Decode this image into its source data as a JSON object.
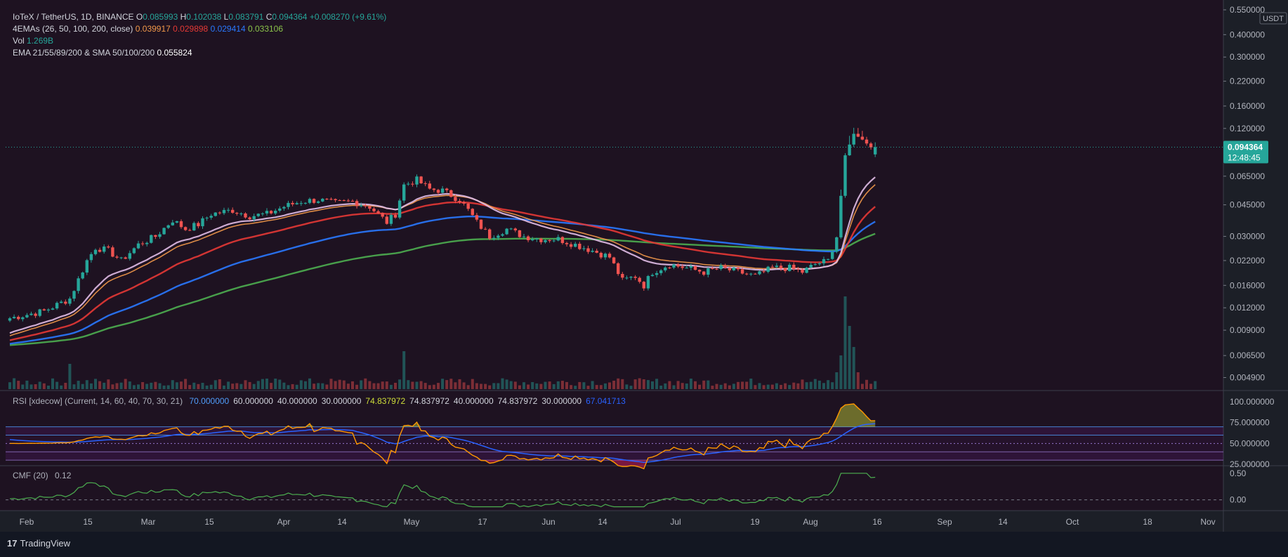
{
  "header": {
    "symbol": "IoTeX / TetherUS, 1D, BINANCE",
    "ohlc": [
      {
        "k": "O",
        "v": "0.085993"
      },
      {
        "k": "H",
        "v": "0.102038"
      },
      {
        "k": "L",
        "v": "0.083791"
      },
      {
        "k": "C",
        "v": "0.094364"
      }
    ],
    "change": "+0.008270 (+9.61%)",
    "change_color": "#26a69a",
    "ema4_label": "4EMAs (26, 50, 100, 200, close)",
    "ema4_values": [
      {
        "v": "0.039917",
        "color": "#f2994a"
      },
      {
        "v": "0.029898",
        "color": "#e53935"
      },
      {
        "v": "0.029414",
        "color": "#2979ff"
      },
      {
        "v": "0.033106",
        "color": "#8bc34a"
      }
    ],
    "vol_label": "Vol",
    "vol_value": "1.269B",
    "vol_color": "#26a69a",
    "ema_sma_label": "EMA 21/55/89/200 & SMA 50/100/200",
    "ema_sma_value": "0.055824",
    "ema_sma_color": "#ffffff"
  },
  "price_axis": {
    "currency": "USDT",
    "last_price": "0.094364",
    "countdown": "12:48:45",
    "last_color": "#26a69a"
  },
  "rsi": {
    "label": "RSI [xdecow] (Current, 14, 60, 40, 70, 30, 21)",
    "values": [
      {
        "v": "70.000000",
        "color": "#4f9cf9"
      },
      {
        "v": "60.000000",
        "color": "#d1d4dc"
      },
      {
        "v": "40.000000",
        "color": "#d1d4dc"
      },
      {
        "v": "30.000000",
        "color": "#d1d4dc"
      },
      {
        "v": "74.837972",
        "color": "#cddc39"
      },
      {
        "v": "74.837972",
        "color": "#d1d4dc"
      },
      {
        "v": "40.000000",
        "color": "#d1d4dc"
      },
      {
        "v": "74.837972",
        "color": "#d1d4dc"
      },
      {
        "v": "30.000000",
        "color": "#d1d4dc"
      },
      {
        "v": "67.041713",
        "color": "#2962ff"
      }
    ],
    "ticks": [
      "100.000000",
      "75.000000",
      "50.000000",
      "25.000000"
    ]
  },
  "cmf": {
    "label": "CMF (20)",
    "value": "0.12",
    "ticks": [
      "0.50",
      "0.00"
    ]
  },
  "branding": {
    "logo": "17",
    "name": "TradingView"
  },
  "chart_data": {
    "type": "candlestick",
    "x_ticks": [
      "Feb",
      "15",
      "Mar",
      "15",
      "Apr",
      "14",
      "May",
      "17",
      "Jun",
      "14",
      "Jul",
      "19",
      "Aug",
      "16",
      "Sep",
      "14",
      "Oct",
      "18",
      "Nov"
    ],
    "y_ticks": [
      "0.550000",
      "0.400000",
      "0.300000",
      "0.220000",
      "0.160000",
      "0.120000",
      "0.065000",
      "0.045000",
      "0.030000",
      "0.022000",
      "0.016000",
      "0.012000",
      "0.009000",
      "0.006500",
      "0.004900"
    ],
    "y_scale": "log",
    "grid": false,
    "price_anchors": [
      [
        0,
        0.0105
      ],
      [
        8,
        0.0115
      ],
      [
        14,
        0.0135
      ],
      [
        18,
        0.022
      ],
      [
        20,
        0.026
      ],
      [
        23,
        0.025
      ],
      [
        26,
        0.022
      ],
      [
        30,
        0.027
      ],
      [
        34,
        0.03
      ],
      [
        38,
        0.037
      ],
      [
        41,
        0.033
      ],
      [
        44,
        0.035
      ],
      [
        47,
        0.04
      ],
      [
        52,
        0.042
      ],
      [
        56,
        0.039
      ],
      [
        60,
        0.04
      ],
      [
        64,
        0.044
      ],
      [
        68,
        0.047
      ],
      [
        72,
        0.048
      ],
      [
        76,
        0.046
      ],
      [
        80,
        0.047
      ],
      [
        84,
        0.044
      ],
      [
        88,
        0.036
      ],
      [
        90,
        0.04
      ],
      [
        92,
        0.058
      ],
      [
        95,
        0.062
      ],
      [
        98,
        0.055
      ],
      [
        101,
        0.054
      ],
      [
        105,
        0.048
      ],
      [
        107,
        0.042
      ],
      [
        109,
        0.036
      ],
      [
        112,
        0.03
      ],
      [
        116,
        0.033
      ],
      [
        120,
        0.03
      ],
      [
        124,
        0.029
      ],
      [
        128,
        0.029
      ],
      [
        132,
        0.027
      ],
      [
        136,
        0.025
      ],
      [
        140,
        0.023
      ],
      [
        143,
        0.017
      ],
      [
        146,
        0.018
      ],
      [
        148,
        0.016
      ],
      [
        150,
        0.019
      ],
      [
        154,
        0.021
      ],
      [
        158,
        0.02
      ],
      [
        162,
        0.019
      ],
      [
        166,
        0.02
      ],
      [
        170,
        0.019
      ],
      [
        174,
        0.018
      ],
      [
        178,
        0.02
      ],
      [
        182,
        0.02
      ],
      [
        185,
        0.019
      ],
      [
        188,
        0.021
      ],
      [
        191,
        0.022
      ],
      [
        193,
        0.03
      ],
      [
        195,
        0.085
      ],
      [
        197,
        0.112
      ],
      [
        199,
        0.104
      ],
      [
        201,
        0.094
      ],
      [
        202,
        0.0944
      ]
    ],
    "volume_spikes": [
      [
        14,
        3
      ],
      [
        92,
        4.5
      ],
      [
        193,
        2
      ],
      [
        194,
        4
      ],
      [
        195,
        11
      ],
      [
        196,
        7.5
      ],
      [
        197,
        5
      ],
      [
        198,
        2
      ]
    ],
    "ema_periods": [
      26,
      50,
      100,
      200
    ],
    "ema_colors": [
      "#f2994a",
      "#e53935",
      "#2979ff",
      "#4caf50"
    ],
    "rsi_levels": [
      70,
      60,
      40,
      30
    ],
    "rsi_ylim": [
      25,
      100
    ],
    "cmf_ylim": [
      -0.15,
      0.55
    ]
  }
}
